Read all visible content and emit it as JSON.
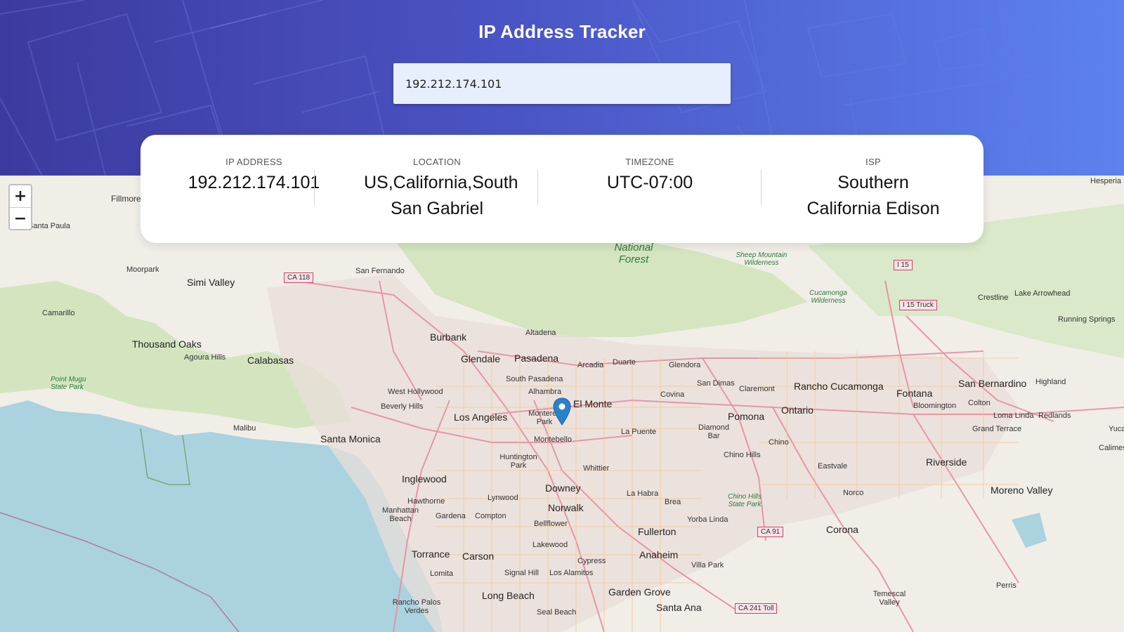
{
  "header": {
    "title": "IP Address Tracker"
  },
  "search": {
    "value": "192.212.174.101"
  },
  "info": {
    "ip_label": "IP ADDRESS",
    "ip_value": "192.212.174.101",
    "location_label": "LOCATION",
    "location_value": "US,California,South San Gabriel",
    "timezone_label": "TIMEZONE",
    "timezone_value": "UTC-07:00",
    "isp_label": "ISP",
    "isp_value": "Southern California Edison"
  },
  "map": {
    "zoom_in": "+",
    "zoom_out": "−",
    "labels": {
      "fillmore": "Fillmore",
      "santa_paula": "Santa Paula",
      "moorpark": "Moorpark",
      "simi_valley": "Simi Valley",
      "camarillo": "Camarillo",
      "thousand_oaks": "Thousand Oaks",
      "agoura_hills": "Agoura Hills",
      "calabasas": "Calabasas",
      "point_mugu": "Point Mugu State Park",
      "malibu": "Malibu",
      "santa_monica": "Santa Monica",
      "san_fernando": "San Fernando",
      "burbank": "Burbank",
      "glendale": "Glendale",
      "pasadena": "Pasadena",
      "altadena": "Altadena",
      "arcadia": "Arcadia",
      "duarte": "Duarte",
      "glendora": "Glendora",
      "south_pasadena": "South Pasadena",
      "alhambra": "Alhambra",
      "west_hollywood": "West Hollywood",
      "beverly_hills": "Beverly Hills",
      "los_angeles": "Los Angeles",
      "monterey_park": "Monterey Park",
      "el_monte": "El Monte",
      "covina": "Covina",
      "san_dimas": "San Dimas",
      "claremont": "Claremont",
      "rancho_cucamonga": "Rancho Cucamonga",
      "fontana": "Fontana",
      "san_bernardino": "San Bernardino",
      "highland": "Highland",
      "ontario": "Ontario",
      "pomona": "Pomona",
      "diamond_bar": "Diamond Bar",
      "la_puente": "La Puente",
      "montebello": "Montebello",
      "huntington_park": "Huntington Park",
      "whittier": "Whittier",
      "inglewood": "Inglewood",
      "hawthorne": "Hawthorne",
      "lynwood": "Lynwood",
      "downey": "Downey",
      "manhattan_beach": "Manhattan Beach",
      "gardena": "Gardena",
      "compton": "Compton",
      "norwalk": "Norwalk",
      "bellflower": "Bellflower",
      "la_habra": "La Habra",
      "brea": "Brea",
      "yorba_linda": "Yorba Linda",
      "chino": "Chino",
      "chino_hills": "Chino Hills",
      "chino_hills_park": "Chino Hills State Park",
      "eastvale": "Eastvale",
      "norco": "Norco",
      "corona": "Corona",
      "riverside": "Riverside",
      "moreno_valley": "Moreno Valley",
      "loma_linda": "Loma Linda",
      "redlands": "Redlands",
      "colton": "Colton",
      "bloomington": "Bloomington",
      "grand_terrace": "Grand Terrace",
      "fullerton": "Fullerton",
      "anaheim": "Anaheim",
      "torrance": "Torrance",
      "carson": "Carson",
      "lakewood": "Lakewood",
      "cypress": "Cypress",
      "lomita": "Lomita",
      "signal_hill": "Signal Hill",
      "los_alamitos": "Los Alamitos",
      "long_beach": "Long Beach",
      "garden_grove": "Garden Grove",
      "santa_ana": "Santa Ana",
      "villa_park": "Villa Park",
      "rancho_palos_verdes": "Rancho Palos Verdes",
      "seal_beach": "Seal Beach",
      "temescal_valley": "Temescal Valley",
      "perris": "Perris",
      "national_forest": "National Forest",
      "sheep_mountain": "Sheep Mountain Wilderness",
      "cucamonga_wilderness": "Cucamonga Wilderness",
      "crestline": "Crestline",
      "lake_arrowhead": "Lake Arrowhead",
      "running_springs": "Running Springs",
      "hesperia": "Hesperia",
      "calimesa": "Calimes",
      "yucaipa": "Yuca",
      "ca118": "CA 118",
      "i15": "I 15",
      "i15truck": "I 15 Truck",
      "ca91": "CA 91",
      "ca241": "CA 241 Toll"
    }
  }
}
